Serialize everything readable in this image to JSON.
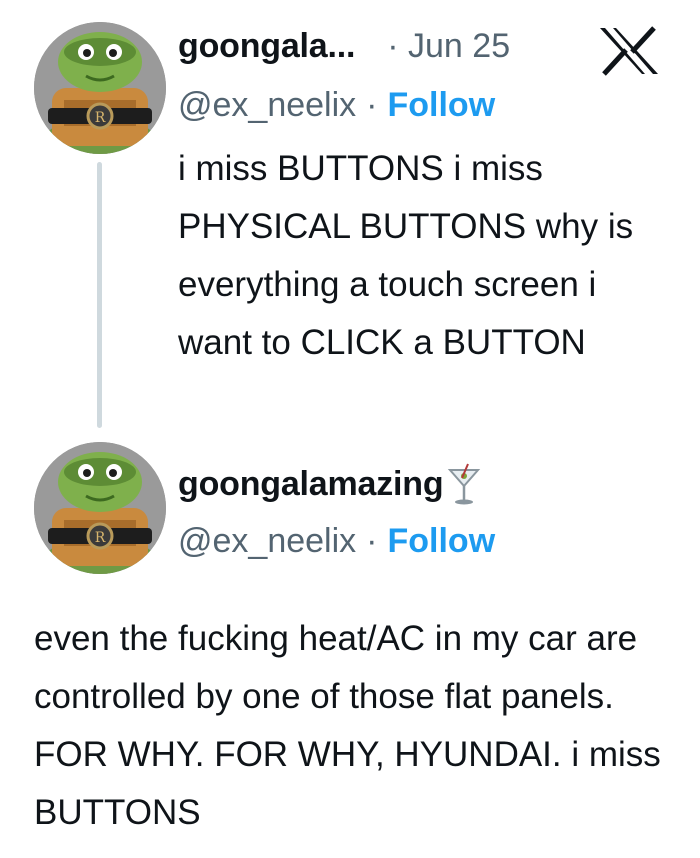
{
  "tweet1": {
    "display_name": "goongala...",
    "date": "· Jun 25",
    "handle": "@ex_neelix",
    "separator": "·",
    "follow_label": "Follow",
    "text": "i miss BUTTONS i miss PHYSICAL BUTTONS why is everything a touch screen i want to CLICK a BUTTON"
  },
  "tweet2": {
    "display_name": "goongalamazing",
    "handle": "@ex_neelix",
    "separator": "·",
    "follow_label": "Follow",
    "text": "even the fucking heat/AC in my car are controlled by one of those flat panels. FOR WHY. FOR WHY, HYUNDAI. i miss BUTTONS"
  },
  "icons": {
    "brand": "x-logo-icon",
    "name_emoji": "cocktail-glass-icon",
    "avatar": "ninja-turtle-avatar"
  },
  "colors": {
    "text": "#0f1419",
    "secondary_text": "#536471",
    "follow": "#1d9bf0",
    "thread_line": "#cfd9de"
  }
}
